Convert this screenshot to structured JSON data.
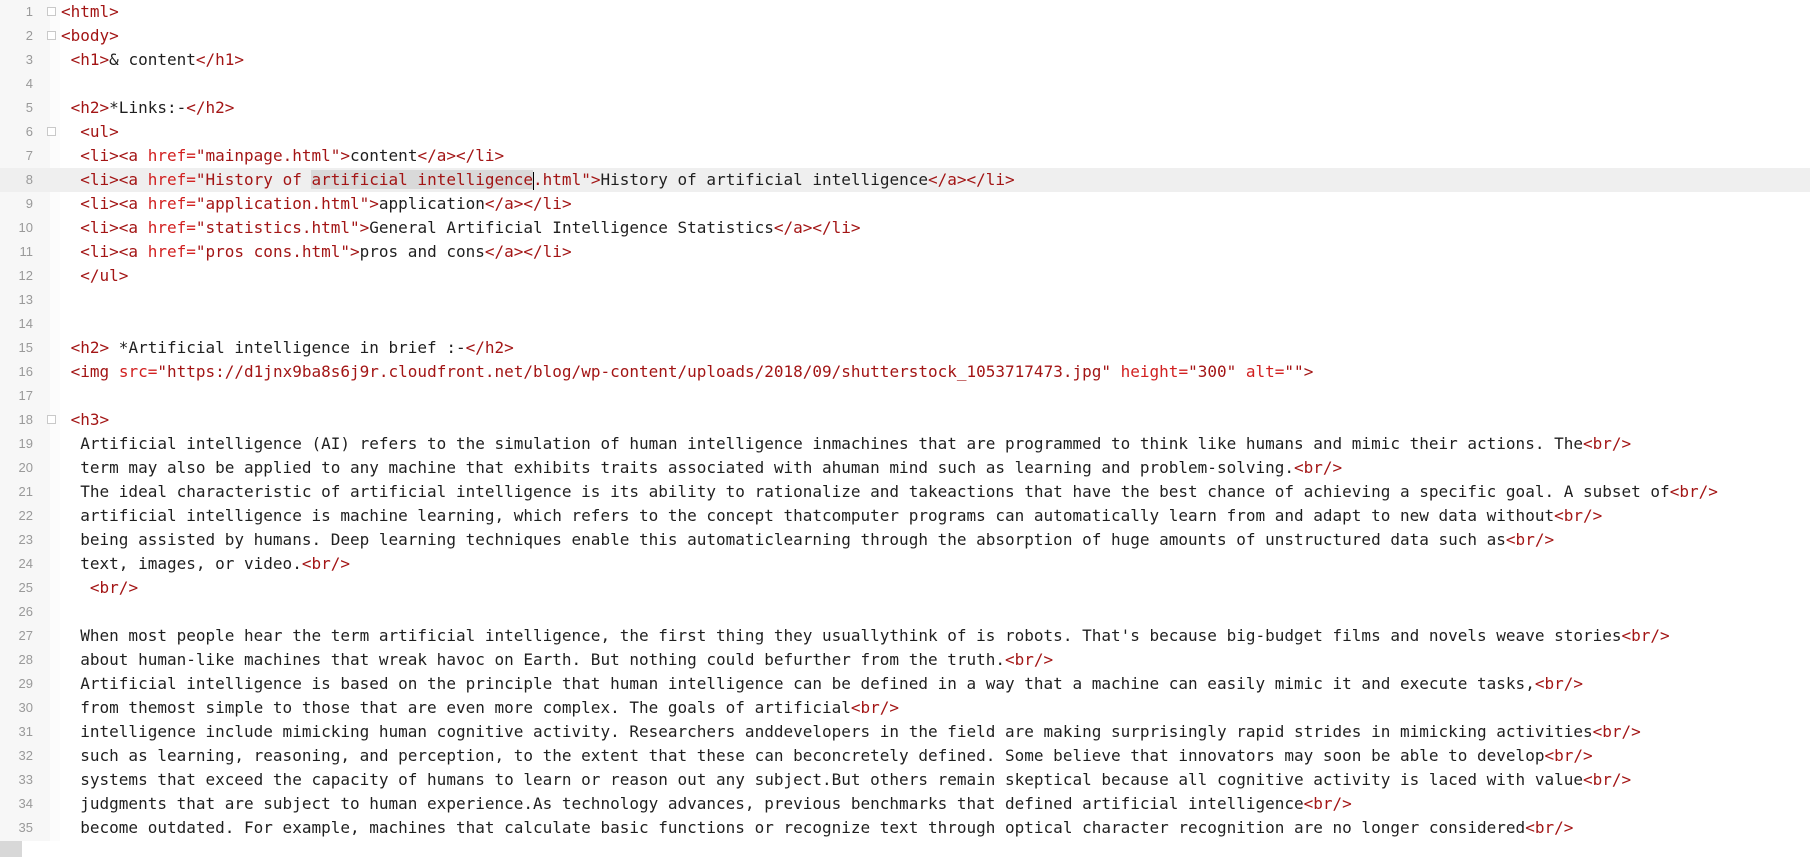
{
  "editor": {
    "current_line": 8,
    "lines": [
      [
        [
          "tag",
          "<html>"
        ]
      ],
      [
        [
          "tag",
          "<body>"
        ]
      ],
      [
        [
          "txt",
          " "
        ],
        [
          "tag",
          "<h1>"
        ],
        [
          "txt",
          "& content"
        ],
        [
          "tag",
          "</h1>"
        ]
      ],
      [],
      [
        [
          "txt",
          " "
        ],
        [
          "tag",
          "<h2>"
        ],
        [
          "txt",
          "*Links:-"
        ],
        [
          "tag",
          "</h2>"
        ]
      ],
      [
        [
          "txt",
          "  "
        ],
        [
          "tag",
          "<ul>"
        ]
      ],
      [
        [
          "txt",
          "  "
        ],
        [
          "tag",
          "<li><a "
        ],
        [
          "attr",
          "href="
        ],
        [
          "str",
          "\"mainpage.html\""
        ],
        [
          "tag",
          ">"
        ],
        [
          "txt",
          "content"
        ],
        [
          "tag",
          "</a></li>"
        ]
      ],
      [
        [
          "txt",
          "  "
        ],
        [
          "tag",
          "<li><a "
        ],
        [
          "attr",
          "href="
        ],
        [
          "str",
          "\"History of "
        ],
        [
          "hl",
          "artificial intelligence"
        ],
        [
          "caret",
          ""
        ],
        [
          "str",
          ".html\""
        ],
        [
          "tag",
          ">"
        ],
        [
          "txt",
          "History of artificial intelligence"
        ],
        [
          "tag",
          "</a></li>"
        ]
      ],
      [
        [
          "txt",
          "  "
        ],
        [
          "tag",
          "<li><a "
        ],
        [
          "attr",
          "href="
        ],
        [
          "str",
          "\"application.html\""
        ],
        [
          "tag",
          ">"
        ],
        [
          "txt",
          "application"
        ],
        [
          "tag",
          "</a></li>"
        ]
      ],
      [
        [
          "txt",
          "  "
        ],
        [
          "tag",
          "<li><a "
        ],
        [
          "attr",
          "href="
        ],
        [
          "str",
          "\"statistics.html\""
        ],
        [
          "tag",
          ">"
        ],
        [
          "txt",
          "General Artificial Intelligence Statistics"
        ],
        [
          "tag",
          "</a></li>"
        ]
      ],
      [
        [
          "txt",
          "  "
        ],
        [
          "tag",
          "<li><a "
        ],
        [
          "attr",
          "href="
        ],
        [
          "str",
          "\"pros cons.html\""
        ],
        [
          "tag",
          ">"
        ],
        [
          "txt",
          "pros and cons"
        ],
        [
          "tag",
          "</a></li>"
        ]
      ],
      [
        [
          "txt",
          "  "
        ],
        [
          "tag",
          "</ul>"
        ]
      ],
      [],
      [],
      [
        [
          "txt",
          " "
        ],
        [
          "tag",
          "<h2>"
        ],
        [
          "txt",
          " *Artificial intelligence in brief :-"
        ],
        [
          "tag",
          "</h2>"
        ]
      ],
      [
        [
          "txt",
          " "
        ],
        [
          "tag",
          "<img "
        ],
        [
          "attr",
          "src="
        ],
        [
          "str",
          "\"https://d1jnx9ba8s6j9r.cloudfront.net/blog/wp-content/uploads/2018/09/shutterstock_1053717473.jpg\""
        ],
        [
          "txt",
          " "
        ],
        [
          "attr",
          "height="
        ],
        [
          "str",
          "\"300\""
        ],
        [
          "txt",
          " "
        ],
        [
          "attr",
          "alt="
        ],
        [
          "str",
          "\"\""
        ],
        [
          "tag",
          ">"
        ]
      ],
      [],
      [
        [
          "txt",
          " "
        ],
        [
          "tag",
          "<h3>"
        ]
      ],
      [
        [
          "txt",
          "  Artificial intelligence (AI) refers to the simulation of human intelligence inmachines that are programmed to think like humans and mimic their actions. The"
        ],
        [
          "tag",
          "<br/>"
        ]
      ],
      [
        [
          "txt",
          "  term may also be applied to any machine that exhibits traits associated with ahuman mind such as learning and problem-solving."
        ],
        [
          "tag",
          "<br/>"
        ]
      ],
      [
        [
          "txt",
          "  The ideal characteristic of artificial intelligence is its ability to rationalize and takeactions that have the best chance of achieving a specific goal. A subset of"
        ],
        [
          "tag",
          "<br/>"
        ]
      ],
      [
        [
          "txt",
          "  artificial intelligence is machine learning, which refers to the concept thatcomputer programs can automatically learn from and adapt to new data without"
        ],
        [
          "tag",
          "<br/>"
        ]
      ],
      [
        [
          "txt",
          "  being assisted by humans. Deep learning techniques enable this automaticlearning through the absorption of huge amounts of unstructured data such as"
        ],
        [
          "tag",
          "<br/>"
        ]
      ],
      [
        [
          "txt",
          "  text, images, or video."
        ],
        [
          "tag",
          "<br/>"
        ]
      ],
      [
        [
          "txt",
          "   "
        ],
        [
          "tag",
          "<br/>"
        ]
      ],
      [],
      [
        [
          "txt",
          "  When most people hear the term artificial intelligence, the first thing they usuallythink of is robots. That's because big-budget films and novels weave stories"
        ],
        [
          "tag",
          "<br/>"
        ]
      ],
      [
        [
          "txt",
          "  about human-like machines that wreak havoc on Earth. But nothing could befurther from the truth."
        ],
        [
          "tag",
          "<br/>"
        ]
      ],
      [
        [
          "txt",
          "  Artificial intelligence is based on the principle that human intelligence can be defined in a way that a machine can easily mimic it and execute tasks,"
        ],
        [
          "tag",
          "<br/>"
        ]
      ],
      [
        [
          "txt",
          "  from themost simple to those that are even more complex. The goals of artificial"
        ],
        [
          "tag",
          "<br/>"
        ]
      ],
      [
        [
          "txt",
          "  intelligence include mimicking human cognitive activity. Researchers anddevelopers in the field are making surprisingly rapid strides in mimicking activities"
        ],
        [
          "tag",
          "<br/>"
        ]
      ],
      [
        [
          "txt",
          "  such as learning, reasoning, and perception, to the extent that these can beconcretely defined. Some believe that innovators may soon be able to develop"
        ],
        [
          "tag",
          "<br/>"
        ]
      ],
      [
        [
          "txt",
          "  systems that exceed the capacity of humans to learn or reason out any subject.But others remain skeptical because all cognitive activity is laced with value"
        ],
        [
          "tag",
          "<br/>"
        ]
      ],
      [
        [
          "txt",
          "  judgments that are subject to human experience.As technology advances, previous benchmarks that defined artificial intelligence"
        ],
        [
          "tag",
          "<br/>"
        ]
      ],
      [
        [
          "txt",
          "  become outdated. For example, machines that calculate basic functions or recognize text through optical character recognition are no longer considered"
        ],
        [
          "tag",
          "<br/>"
        ]
      ]
    ],
    "fold_lines": [
      1,
      2,
      6,
      18
    ]
  }
}
